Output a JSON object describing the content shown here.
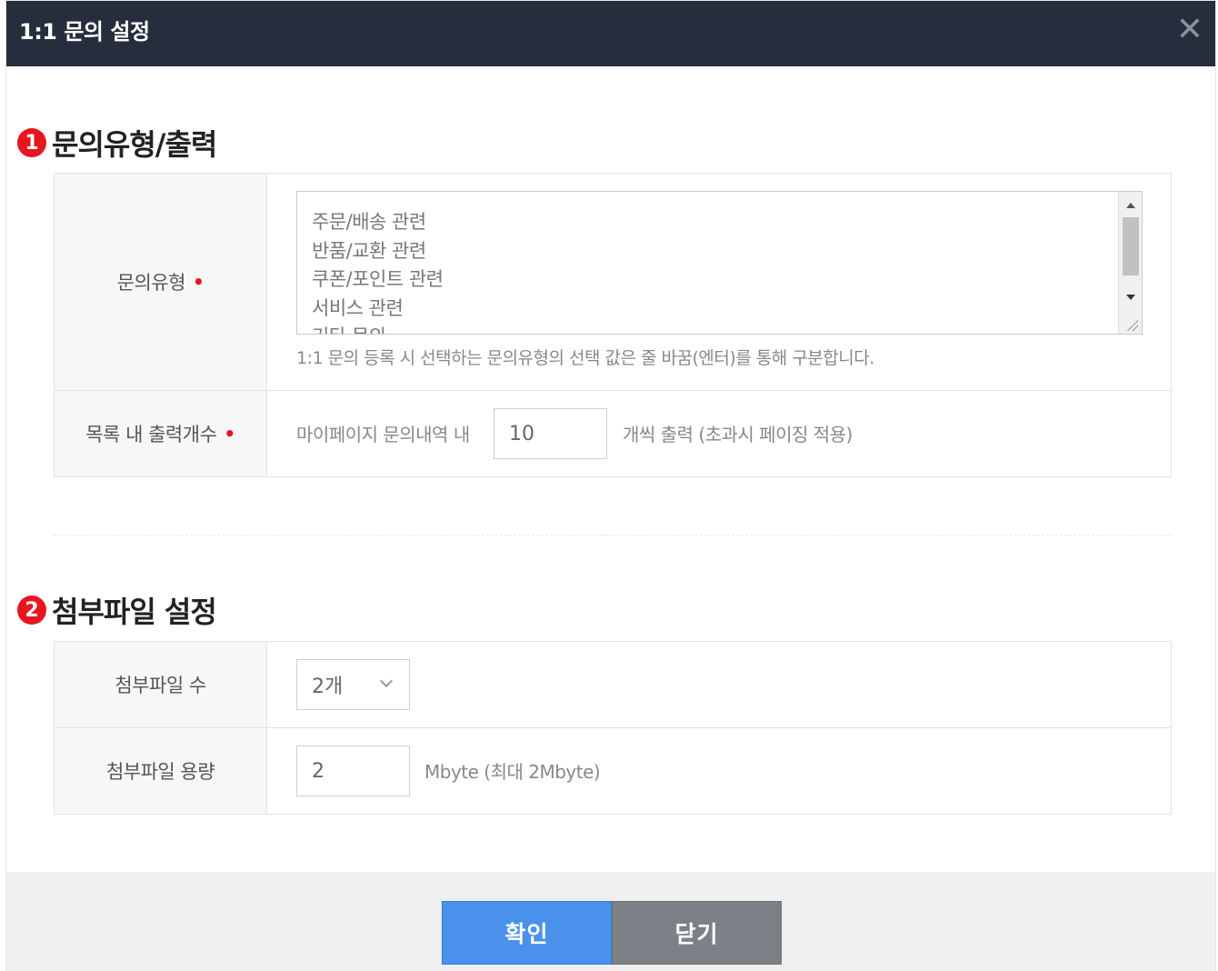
{
  "dialog": {
    "title": "1:1 문의 설정",
    "close_glyph": "✕"
  },
  "section1": {
    "number": "1",
    "title": "문의유형/출력",
    "inquiry_type": {
      "label": "문의유형",
      "required_mark": "•",
      "options": [
        "주문/배송 관련",
        "반품/교환 관련",
        "쿠폰/포인트 관련",
        "서비스 관련",
        "기타 문의"
      ],
      "help": "1:1 문의 등록 시 선택하는 문의유형의 선택 값은 줄 바꿈(엔터)를 통해 구분합니다."
    },
    "list_count": {
      "label": "목록 내 출력개수",
      "required_mark": "•",
      "prefix": "마이페이지 문의내역 내",
      "value": "10",
      "suffix": "개씩 출력 (초과시 페이징 적용)"
    }
  },
  "section2": {
    "number": "2",
    "title": "첨부파일 설정",
    "file_count": {
      "label": "첨부파일 수",
      "selected": "2개"
    },
    "file_size": {
      "label": "첨부파일 용량",
      "value": "2",
      "suffix": "Mbyte (최대 2Mbyte)"
    }
  },
  "footer": {
    "confirm_label": "확인",
    "close_label": "닫기"
  },
  "colors": {
    "titlebar": "#262d3c",
    "accent_red": "#e8141e",
    "confirm_blue": "#4a91eb",
    "close_gray": "#7d8187"
  }
}
